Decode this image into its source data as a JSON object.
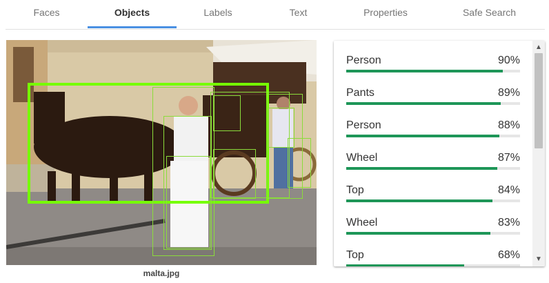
{
  "tabs": [
    {
      "label": "Faces"
    },
    {
      "label": "Objects"
    },
    {
      "label": "Labels"
    },
    {
      "label": "Text"
    },
    {
      "label": "Properties"
    },
    {
      "label": "Safe Search"
    }
  ],
  "active_tab": "Objects",
  "image": {
    "caption": "malta.jpg"
  },
  "results": [
    {
      "label": "Person",
      "percent": "90%",
      "score": 0.9
    },
    {
      "label": "Pants",
      "percent": "89%",
      "score": 0.89
    },
    {
      "label": "Person",
      "percent": "88%",
      "score": 0.88
    },
    {
      "label": "Wheel",
      "percent": "87%",
      "score": 0.87
    },
    {
      "label": "Top",
      "percent": "84%",
      "score": 0.84
    },
    {
      "label": "Wheel",
      "percent": "83%",
      "score": 0.83
    },
    {
      "label": "Top",
      "percent": "68%",
      "score": 0.68
    }
  ],
  "colors": {
    "accent": "#4a90e2",
    "bar": "#1e9658",
    "box": "#76ff03"
  },
  "icons": {
    "scroll_up": "triangle-up-icon",
    "scroll_down": "triangle-down-icon"
  }
}
